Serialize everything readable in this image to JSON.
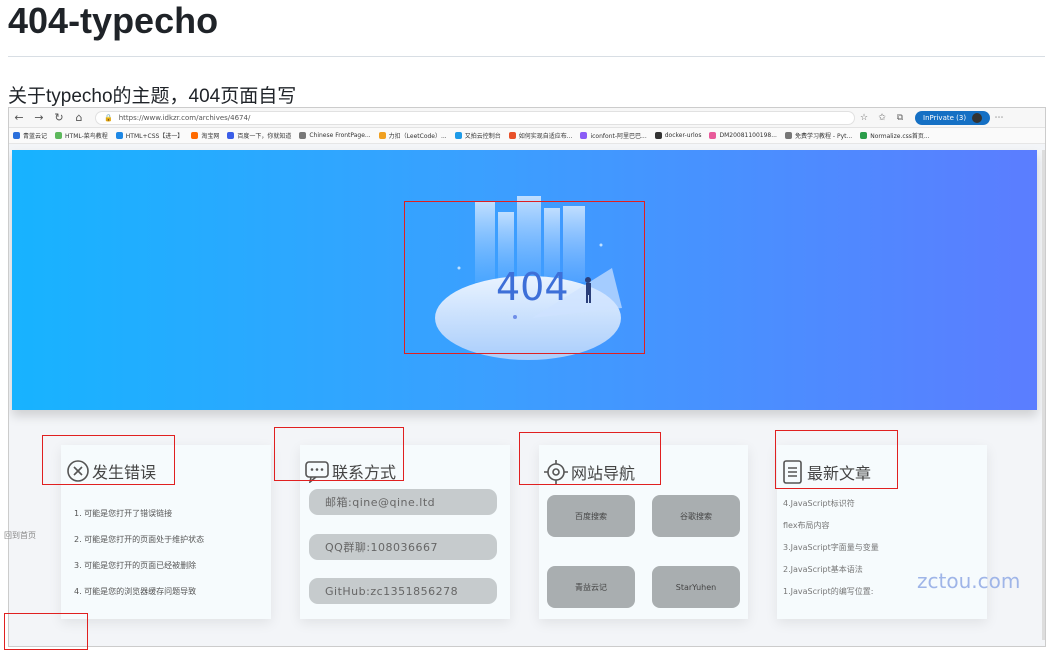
{
  "heading": "404-typecho",
  "description": "关于typecho的主题，404页面自写",
  "browser": {
    "url": "https://www.idkzr.com/archives/4674/",
    "inprivate_label": "InPrivate (3)",
    "bookmarks": [
      {
        "label": "青蓝云记",
        "color": "#2a6fdb"
      },
      {
        "label": "HTML-菜鸟教程",
        "color": "#5db85c"
      },
      {
        "label": "HTML+CSS【进一】",
        "color": "#1e88e5"
      },
      {
        "label": "淘宝网",
        "color": "#ff6a00"
      },
      {
        "label": "百度一下，你就知道",
        "color": "#3b5ee8"
      },
      {
        "label": "Chinese FrontPage...",
        "color": "#777777"
      },
      {
        "label": "力扣（LeetCode）...",
        "color": "#f0a020"
      },
      {
        "label": "又拍云控制台",
        "color": "#1e9be8"
      },
      {
        "label": "如何实现自适应布...",
        "color": "#e8512a"
      },
      {
        "label": "iconfont-阿里巴巴...",
        "color": "#8a5cf6"
      },
      {
        "label": "docker-urlos",
        "color": "#333333"
      },
      {
        "label": "DM20081100198...",
        "color": "#e85a9a"
      },
      {
        "label": "免费学习教程 - Pyt...",
        "color": "#777777"
      },
      {
        "label": "Normalize.css首页...",
        "color": "#2a9d4a"
      }
    ]
  },
  "hero": {
    "code": "404"
  },
  "cards": {
    "error": {
      "title": "发生错误",
      "items": [
        "1. 可能是您打开了错误链接",
        "2. 可能是您打开的页面处于维护状态",
        "3. 可能是您打开的页面已经被删除",
        "4. 可能是您的浏览器缓存问题导致"
      ]
    },
    "contact": {
      "title": "联系方式",
      "items": [
        "邮箱:qine@qine.ltd",
        "QQ群聊:108036667",
        "GitHub:zc1351856278"
      ]
    },
    "nav": {
      "title": "网站导航",
      "buttons": [
        "百度搜索",
        "谷歌搜索",
        "青益云记",
        "StarYuhen"
      ]
    },
    "articles": {
      "title": "最新文章",
      "items": [
        "4.JavaScript标识符",
        "flex布局内容",
        "3.JavaScript字面量与变量",
        "2.JavaScript基本语法",
        "1.JavaScript的编写位置:"
      ]
    }
  },
  "watermark": "zctou.com",
  "back_home": "回到首页",
  "colors": {
    "hero_start": "#17b3ff",
    "hero_end": "#5b7dff",
    "annotation": "#e02020"
  }
}
